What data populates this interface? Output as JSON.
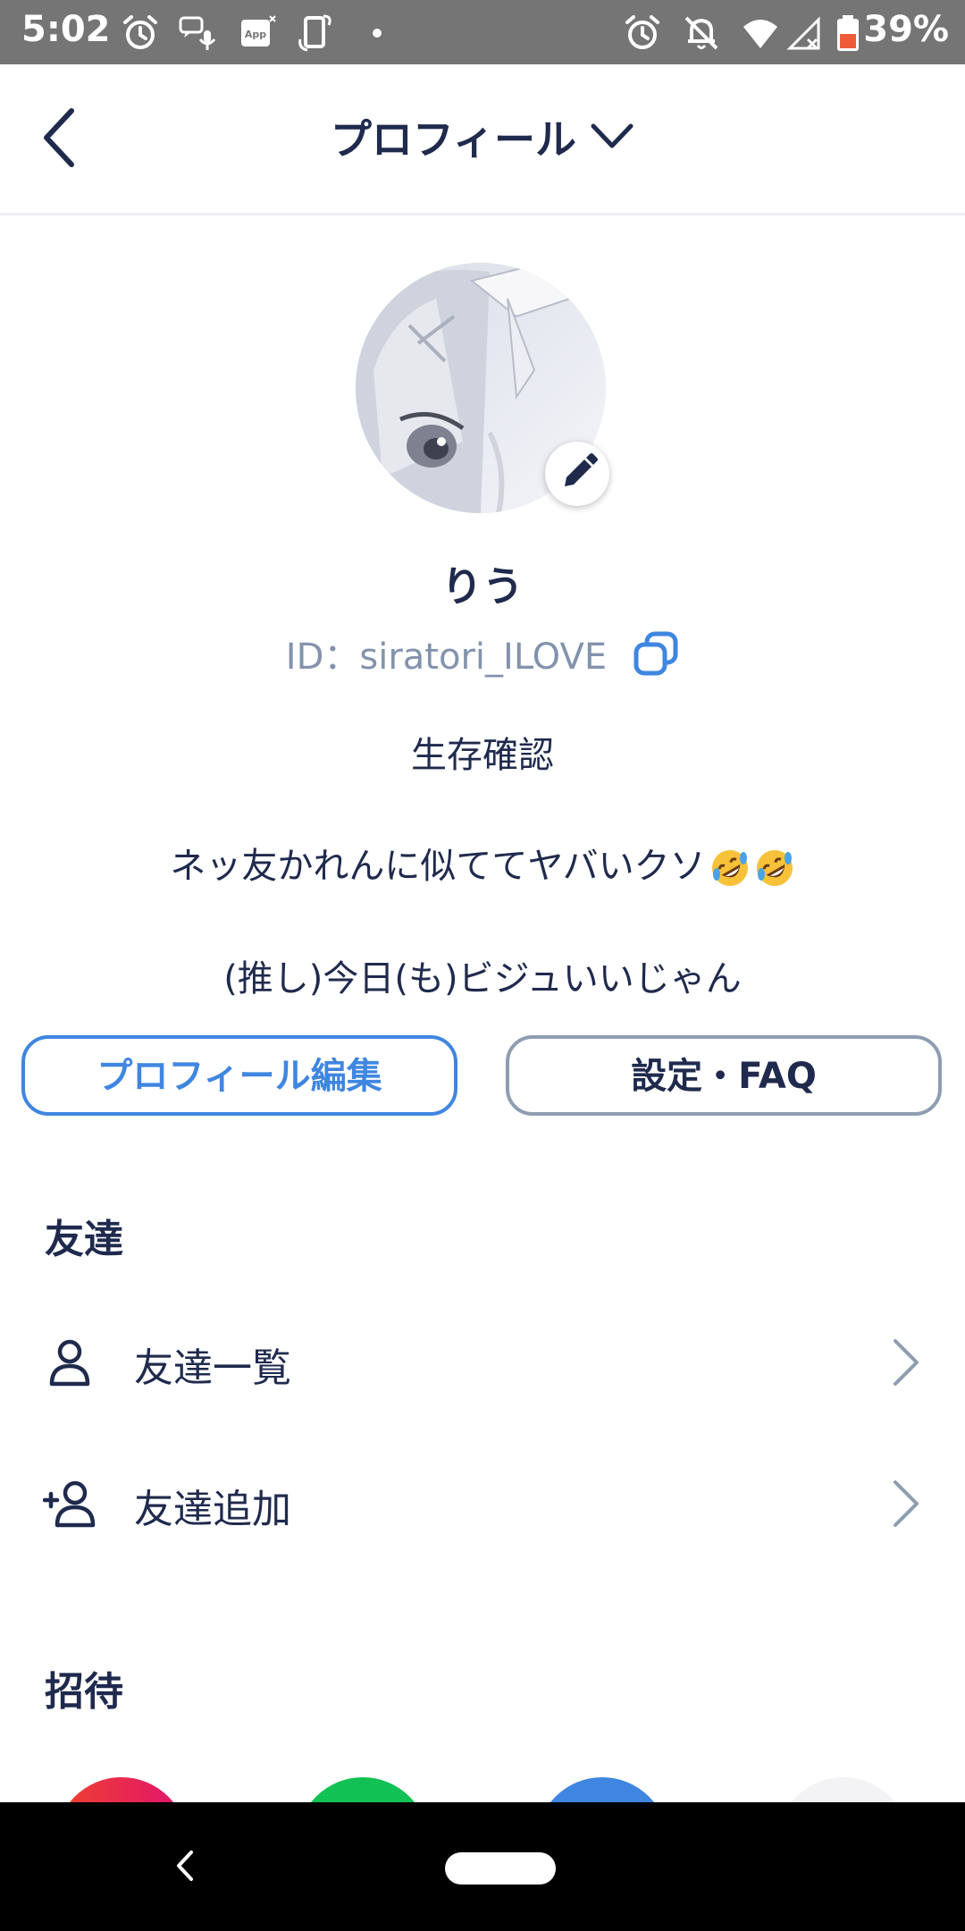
{
  "status_bar": {
    "time": "5:02",
    "battery_percent": "39%",
    "left_icons": [
      "alarm-icon",
      "chat-mic-icon",
      "app-icon",
      "screen-rotate-icon",
      "dot-icon"
    ],
    "right_icons": [
      "alarm-icon",
      "bell-off-icon",
      "wifi-icon",
      "signal-icon",
      "battery-icon"
    ]
  },
  "header": {
    "title": "プロフィール"
  },
  "profile": {
    "name": "りう",
    "id": "ID：siratori_ILOVE",
    "bio": [
      "生存確認",
      "ネッ友かれんに似ててヤバいクソ",
      "(推し)今日(も)ビジュいいじゃん"
    ],
    "bio_emoji": "rolling-on-floor-laughing-emoji"
  },
  "buttons": {
    "edit_profile": "プロフィール編集",
    "settings_faq": "設定・FAQ"
  },
  "friends_section": {
    "title": "友達",
    "items": [
      {
        "label": "友達一覧",
        "icon": "person-icon"
      },
      {
        "label": "友達追加",
        "icon": "person-add-icon"
      }
    ]
  },
  "invite_section": {
    "title": "招待"
  },
  "colors": {
    "accent_blue": "#3f86e0",
    "text_navy": "#1f2a4d",
    "muted_gray_blue": "#8393ad",
    "status_bar_bg": "#757575",
    "battery_low": "#ef5a3a"
  }
}
